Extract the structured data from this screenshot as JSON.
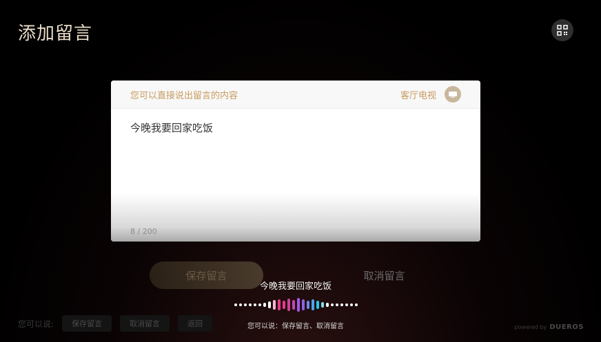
{
  "page": {
    "title": "添加留言",
    "qr_icon": "qr-code-icon"
  },
  "card": {
    "hint": "您可以直接说出留言的内容",
    "device": "客厅电视",
    "device_icon": "tv-icon",
    "message": "今晚我要回家吃饭",
    "char_count": "8 / 200"
  },
  "actions": {
    "save_label": "保存留言",
    "cancel_label": "取消留言"
  },
  "voice": {
    "recognized": "今晚我要回家吃饭",
    "suggest": "您可以说：保存留言、取消留言"
  },
  "bottom_hints": {
    "label": "您可以说:",
    "chips": [
      "保存留言",
      "取消留言",
      "返回"
    ]
  },
  "brand": {
    "powered_by": "powered by",
    "name": "DUEROS"
  },
  "colors": {
    "accent": "#c79b5f",
    "wave_pink": "#e83a8c",
    "wave_purple": "#a357e6",
    "wave_cyan": "#29c6e8"
  }
}
